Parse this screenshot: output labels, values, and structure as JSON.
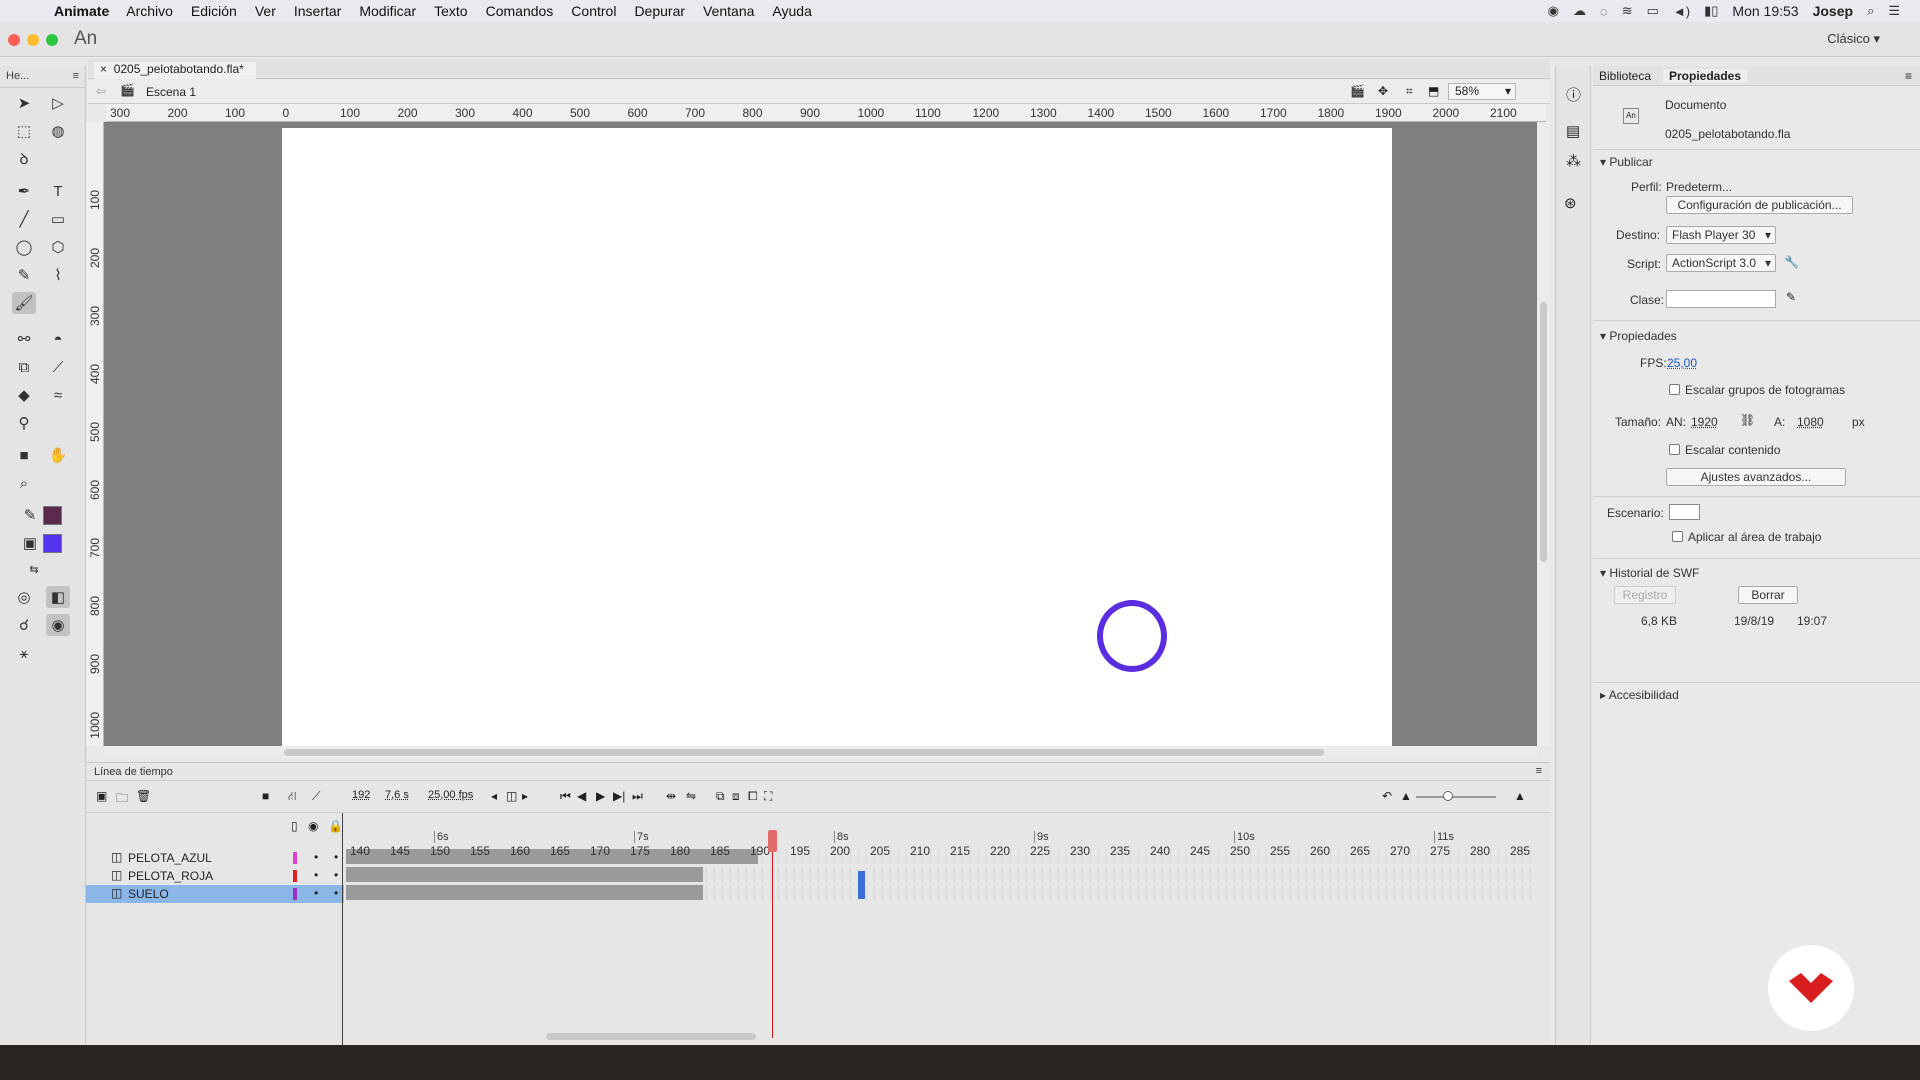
{
  "menubar": {
    "app": "Animate",
    "items": [
      "Archivo",
      "Edición",
      "Ver",
      "Insertar",
      "Modificar",
      "Texto",
      "Comandos",
      "Control",
      "Depurar",
      "Ventana",
      "Ayuda"
    ],
    "clock": "Mon 19:53",
    "user": "Josep"
  },
  "titlebar": {
    "app_short": "An",
    "workspace": "Clásico"
  },
  "tools_panel": {
    "header": "He..."
  },
  "document": {
    "tab": "0205_pelotabotando.fla*",
    "scene": "Escena 1",
    "zoom": "58%"
  },
  "ruler_h": [
    "300",
    "200",
    "100",
    "0",
    "100",
    "200",
    "300",
    "400",
    "500",
    "600",
    "700",
    "800",
    "900",
    "1000",
    "1100",
    "1200",
    "1300",
    "1400",
    "1500",
    "1600",
    "1700",
    "1800",
    "1900",
    "2000",
    "2100"
  ],
  "ruler_v": [
    "100",
    "200",
    "300",
    "400",
    "500",
    "600",
    "700",
    "800",
    "900",
    "1000"
  ],
  "properties": {
    "tabs": [
      "Biblioteca",
      "Propiedades"
    ],
    "doc_label": "Documento",
    "doc_name": "0205_pelotabotando.fla",
    "publish_section": "Publicar",
    "profile_label": "Perfil:",
    "profile_value": "Predeterm...",
    "publish_settings_button": "Configuración de publicación...",
    "target_label": "Destino:",
    "target_value": "Flash Player 30",
    "script_label": "Script:",
    "script_value": "ActionScript 3.0",
    "class_label": "Clase:",
    "properties_section": "Propiedades",
    "fps_label": "FPS:",
    "fps_value": "25,00",
    "scale_frames_label": "Escalar grupos de fotogramas",
    "size_label": "Tamaño:",
    "width_label": "AN:",
    "width_value": "1920",
    "height_label": "A:",
    "height_value": "1080",
    "unit": "px",
    "scale_content_label": "Escalar contenido",
    "advanced_button": "Ajustes avanzados...",
    "stage_label": "Escenario:",
    "apply_workarea_label": "Aplicar al área de trabajo",
    "swf_history_section": "Historial de SWF",
    "log_button": "Registro",
    "clear_button": "Borrar",
    "swf_size": "6,8 KB",
    "swf_date": "19/8/19",
    "swf_time": "19:07",
    "accessibility_section": "Accesibilidad"
  },
  "timeline": {
    "title": "Línea de tiempo",
    "current_frame": "192",
    "time": "7,6 s",
    "fps": "25,00 fps",
    "seconds": [
      "6s",
      "7s",
      "8s",
      "9s",
      "10s",
      "11s"
    ],
    "frame_numbers": [
      "140",
      "145",
      "150",
      "155",
      "160",
      "165",
      "170",
      "175",
      "180",
      "185",
      "190",
      "195",
      "200",
      "205",
      "210",
      "215",
      "220",
      "225",
      "230",
      "235",
      "240",
      "245",
      "250",
      "255",
      "260",
      "265",
      "270",
      "275",
      "280",
      "285"
    ],
    "layers": [
      {
        "name": "PELOTA_AZUL",
        "color": "#e040d0"
      },
      {
        "name": "PELOTA_ROJA",
        "color": "#e02020"
      },
      {
        "name": "SUELO",
        "color": "#9b30c8"
      }
    ]
  },
  "colors": {
    "stroke": "#5a2a4a",
    "fill": "#5533ee",
    "ball": "#5a2ee0",
    "accent": "#8ab6e8",
    "playhead": "#d0171b"
  }
}
